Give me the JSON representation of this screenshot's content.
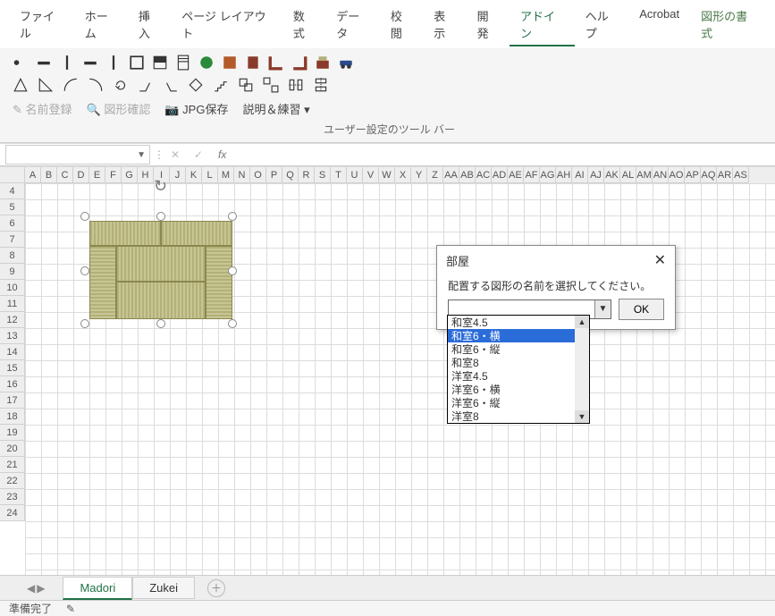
{
  "menu": {
    "items": [
      "ファイル",
      "ホーム",
      "挿入",
      "ページ レイアウト",
      "数式",
      "データ",
      "校閲",
      "表示",
      "開発",
      "アドイン",
      "ヘルプ",
      "Acrobat",
      "図形の書式"
    ],
    "active_index": 9
  },
  "ribbon": {
    "row3": {
      "name_register": "名前登録",
      "shape_check": "図形確認",
      "jpg_save": "JPG保存",
      "explain_practice": "説明＆練習"
    },
    "group_label": "ユーザー設定のツール バー"
  },
  "formula_bar": {
    "name_box": "",
    "fx_label": "fx",
    "formula": ""
  },
  "columns": [
    "A",
    "B",
    "C",
    "D",
    "E",
    "F",
    "G",
    "H",
    "I",
    "J",
    "K",
    "L",
    "M",
    "N",
    "O",
    "P",
    "Q",
    "R",
    "S",
    "T",
    "U",
    "V",
    "W",
    "X",
    "Y",
    "Z",
    "AA",
    "AB",
    "AC",
    "AD",
    "AE",
    "AF",
    "AG",
    "AH",
    "AI",
    "AJ",
    "AK",
    "AL",
    "AM",
    "AN",
    "AO",
    "AP",
    "AQ",
    "AR",
    "AS"
  ],
  "rows": [
    "4",
    "5",
    "6",
    "7",
    "8",
    "9",
    "10",
    "11",
    "12",
    "13",
    "14",
    "15",
    "16",
    "17",
    "18",
    "19",
    "20",
    "21",
    "22",
    "23",
    "24"
  ],
  "dialog": {
    "title": "部屋",
    "message": "配置する図形の名前を選択してください。",
    "input_value": "",
    "ok_label": "OK",
    "options": [
      "和室4.5",
      "和室6・横",
      "和室6・縦",
      "和室8",
      "洋室4.5",
      "洋室6・横",
      "洋室6・縦",
      "洋室8"
    ],
    "selected_index": 1
  },
  "tabs": {
    "items": [
      "Madori",
      "Zukei"
    ],
    "active_index": 0
  },
  "status": {
    "text": "準備完了",
    "acc_icon": "✎"
  }
}
